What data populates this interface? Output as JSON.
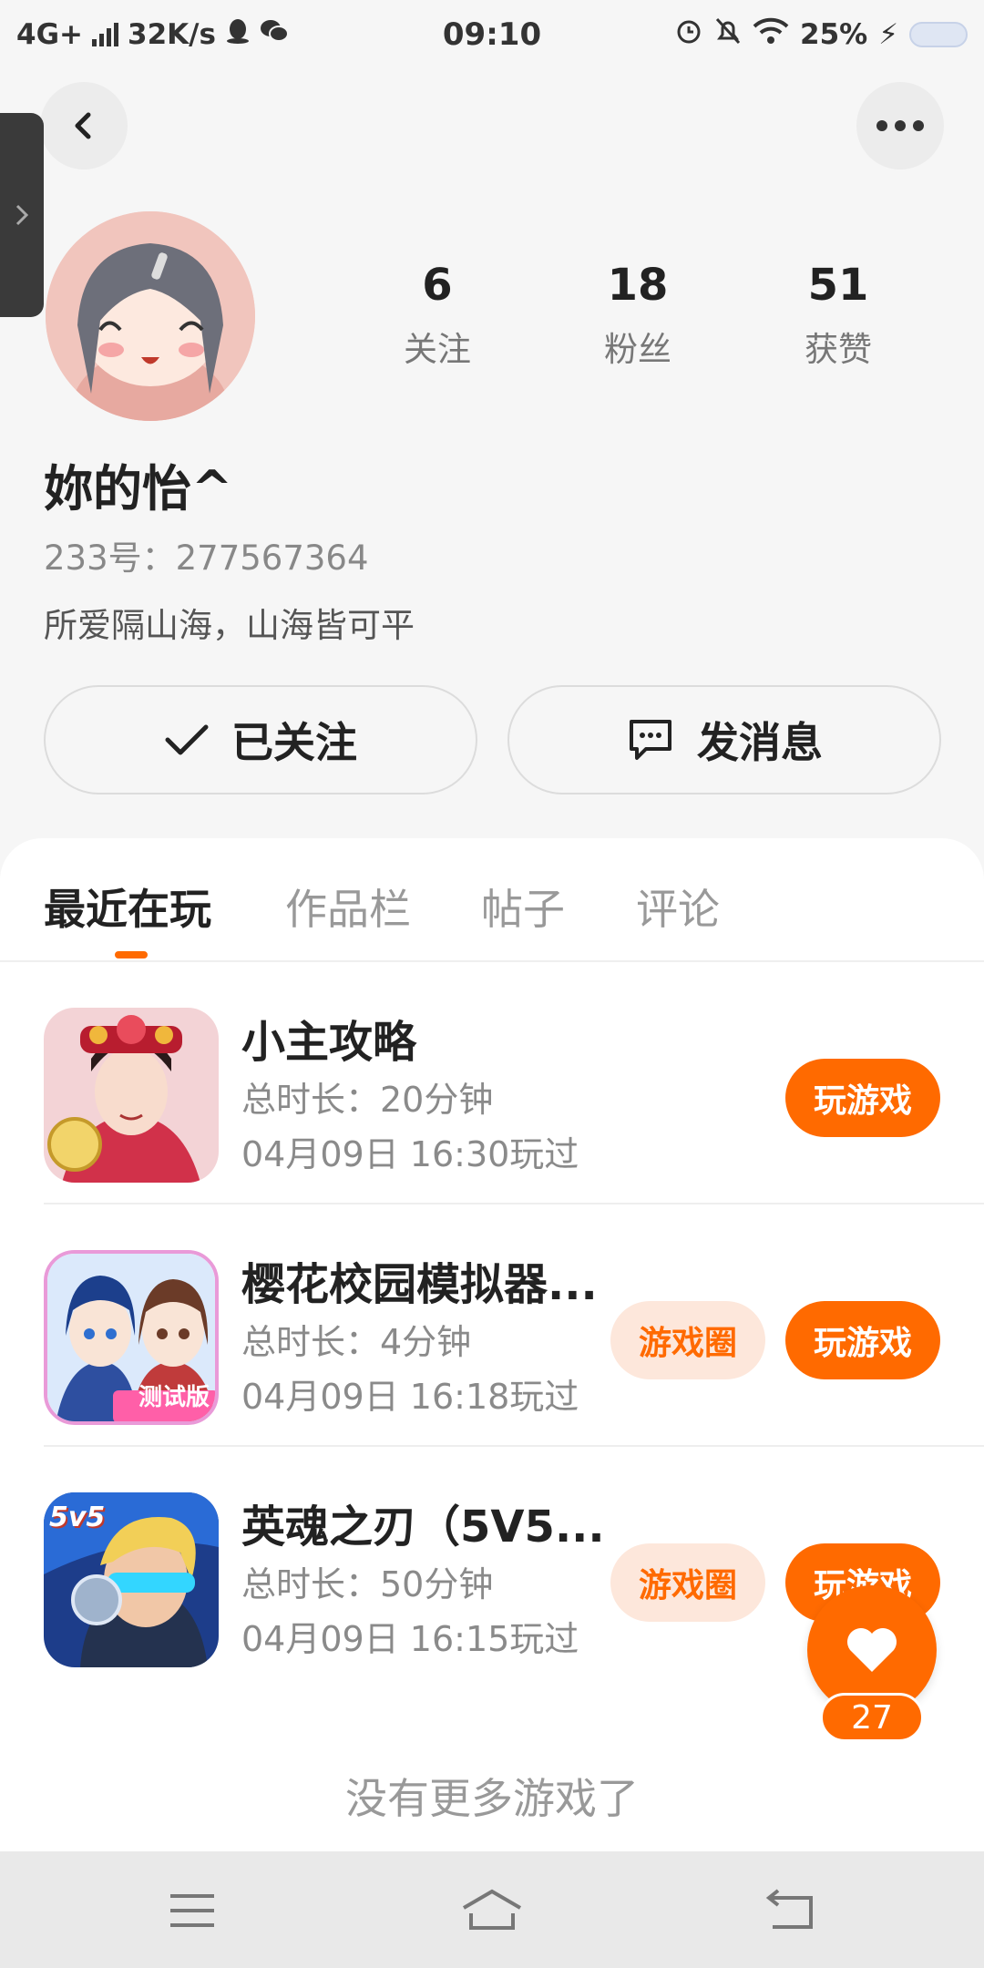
{
  "status_bar": {
    "network": "4G+",
    "speed": "32K/s",
    "time": "09:10",
    "battery": "25%"
  },
  "profile": {
    "name": "妳的怡^",
    "uid": "233号：277567364",
    "bio": "所爱隔山海，山海皆可平",
    "stats": [
      {
        "value": "6",
        "label": "关注"
      },
      {
        "value": "18",
        "label": "粉丝"
      },
      {
        "value": "51",
        "label": "获赞"
      }
    ]
  },
  "actions": {
    "follow_label": "已关注",
    "message_label": "发消息"
  },
  "tabs": [
    {
      "label": "最近在玩",
      "active": true
    },
    {
      "label": "作品栏",
      "active": false
    },
    {
      "label": "帖子",
      "active": false
    },
    {
      "label": "评论",
      "active": false
    }
  ],
  "games": [
    {
      "title": "小主攻略",
      "duration": "总时长：20分钟",
      "last_played": "04月09日 16:30玩过",
      "play_label": "玩游戏",
      "circle_label": ""
    },
    {
      "title": "樱花校园模拟器...",
      "duration": "总时长：4分钟",
      "last_played": "04月09日 16:18玩过",
      "play_label": "玩游戏",
      "circle_label": "游戏圈",
      "icon_badge": "测试版"
    },
    {
      "title": "英魂之刃（5V5...",
      "duration": "总时长：50分钟",
      "last_played": "04月09日 16:15玩过",
      "play_label": "玩游戏",
      "circle_label": "游戏圈",
      "icon_badge": "5v5"
    }
  ],
  "footer_text": "没有更多游戏了",
  "like": {
    "count": "27"
  },
  "colors": {
    "accent": "#ff6a00",
    "accent_light": "#fde7db"
  }
}
